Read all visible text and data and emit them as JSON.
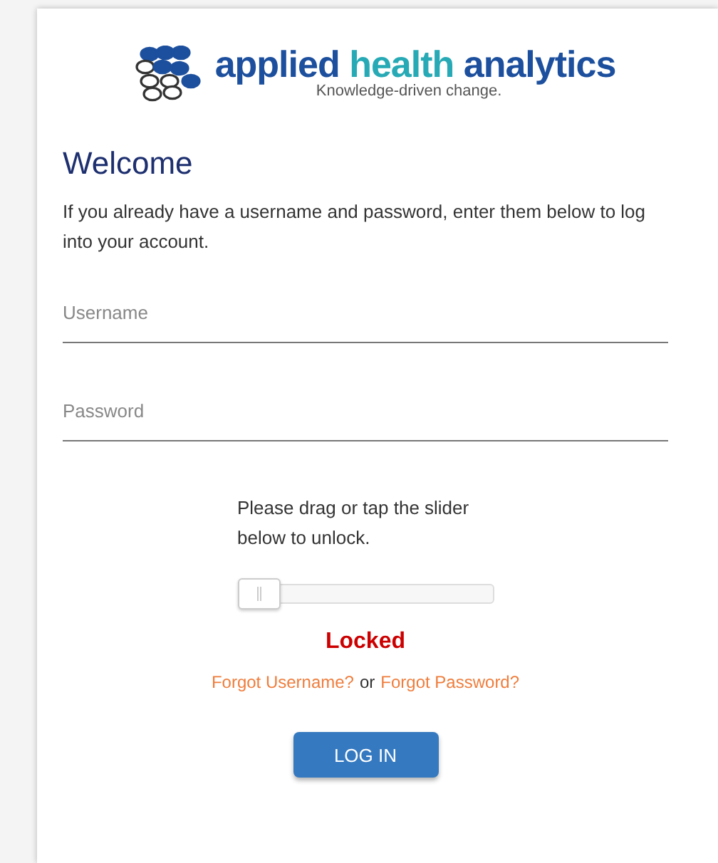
{
  "logo": {
    "parts": [
      {
        "text": "applied",
        "accent": false
      },
      {
        "text": "health",
        "accent": true
      },
      {
        "text": "analytics",
        "accent": false
      }
    ],
    "tagline": "Knowledge-driven change."
  },
  "heading": "Welcome",
  "intro": "If you already have a username and password, enter them below to log into your account.",
  "fields": [
    {
      "placeholder": "Username"
    },
    {
      "placeholder": "Password"
    }
  ],
  "slider": {
    "instruction": "Please drag or tap the slider below to unlock.",
    "level": 0,
    "locked": true,
    "status": "Locked"
  },
  "recovery": {
    "first": "Forgot Username?",
    "joiner": "or",
    "second": "Forgot Password?"
  },
  "button": "LOG IN"
}
